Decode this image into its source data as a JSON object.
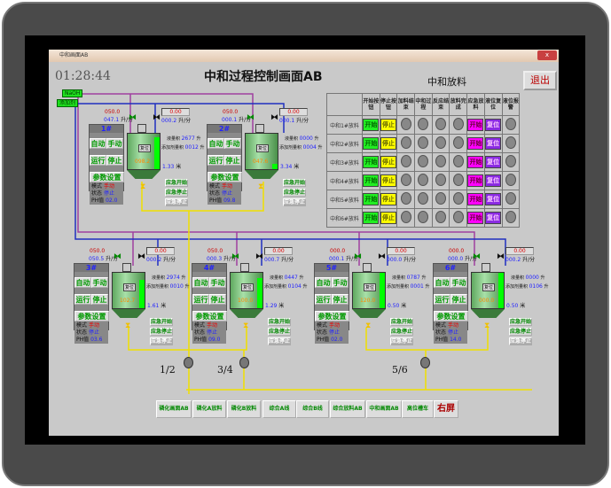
{
  "window": {
    "title": "中和画面AB",
    "close": "x"
  },
  "header": {
    "clock": "01:28:44",
    "title": "中和过程控制画面AB",
    "subtitle": "中和放料",
    "exit": "退出"
  },
  "pipes": {
    "naoh": "NaOH",
    "additive": "添加剂"
  },
  "units_labels": {
    "auto": "自动",
    "manual": "手动",
    "run": "运行",
    "stop": "停止",
    "params": "参数设置",
    "mode": "模式",
    "state": "状态",
    "ph": "PH值",
    "flow_unit": "升/分",
    "vol_unit": "升",
    "level_unit": "米",
    "total_label": "液量积",
    "additive_label": "添加剂量积",
    "tank_label": "复位",
    "emg_start": "应急开始",
    "emg_stop": "应急停止",
    "emg_stop2": "应急停止",
    "valve_tag": "手"
  },
  "units": [
    {
      "name": "1#",
      "set": "050.0",
      "flow1": "047.1",
      "disp": "0.00",
      "flow2": "000.2",
      "total": "2677",
      "additive": "0012",
      "tank": "098.2",
      "level": "1.33",
      "mode": "手动",
      "state": "停止",
      "ph": "02.0",
      "fill": 0.9
    },
    {
      "name": "2#",
      "set": "050.0",
      "flow1": "000.1",
      "disp": "0.00",
      "flow2": "000.1",
      "total": "0000",
      "additive": "0004",
      "tank": "047.6",
      "level": "3.34",
      "mode": "手动",
      "state": "停止",
      "ph": "09.8",
      "fill": 0.15
    },
    {
      "name": "3#",
      "set": "050.0",
      "flow1": "050.5",
      "disp": "0.00",
      "flow2": "000.2",
      "total": "2974",
      "additive": "0010",
      "tank": "102.7",
      "level": "1.61",
      "mode": "手动",
      "state": "停止",
      "ph": "03.6",
      "fill": 0.8
    },
    {
      "name": "4#",
      "set": "050.0",
      "flow1": "000.3",
      "disp": "0.00",
      "flow2": "000.7",
      "total": "0447",
      "additive": "0104",
      "tank": "100.0",
      "level": "1.29",
      "mode": "手动",
      "state": "停止",
      "ph": "09.0",
      "fill": 0.85
    },
    {
      "name": "5#",
      "set": "000.0",
      "flow1": "000.1",
      "disp": "0.00",
      "flow2": "000.0",
      "total": "0787",
      "additive": "0001",
      "tank": "120.0",
      "level": "0.50",
      "mode": "手动",
      "state": "停止",
      "ph": "02.0",
      "fill": 1.0
    },
    {
      "name": "6#",
      "set": "000.0",
      "flow1": "000.0",
      "disp": "0.00",
      "flow2": "000.2",
      "total": "0000",
      "additive": "0106",
      "tank": "000.0",
      "level": "0.50",
      "mode": "手动",
      "state": "停止",
      "ph": "14.0",
      "fill": 1.0
    }
  ],
  "table": {
    "headers": [
      "开始按钮",
      "停止按钮",
      "加料结束",
      "中和过程",
      "反应结束",
      "放料完成",
      "应急放料",
      "液位复位",
      "液位报警"
    ],
    "rows": [
      "中和1#放料",
      "中和2#放料",
      "中和3#放料",
      "中和4#放料",
      "中和5#放料",
      "中和6#放料"
    ],
    "start": "开始",
    "stop": "停止",
    "emg": "开始",
    "reset": "复位",
    "colors": {
      "start": "#22ee22",
      "stop": "#ffff00",
      "emg": "#ff00ff",
      "reset": "#8a2be2",
      "lamp": "#888888"
    }
  },
  "groups": [
    "1/2",
    "3/4",
    "5/6"
  ],
  "bottom_buttons": [
    "磷化画面AB",
    "磷化A放料",
    "磷化B放料",
    "综合A线",
    "综合B线",
    "综合放料AB",
    "中和画面AB",
    "高位槽车",
    "右屏"
  ]
}
